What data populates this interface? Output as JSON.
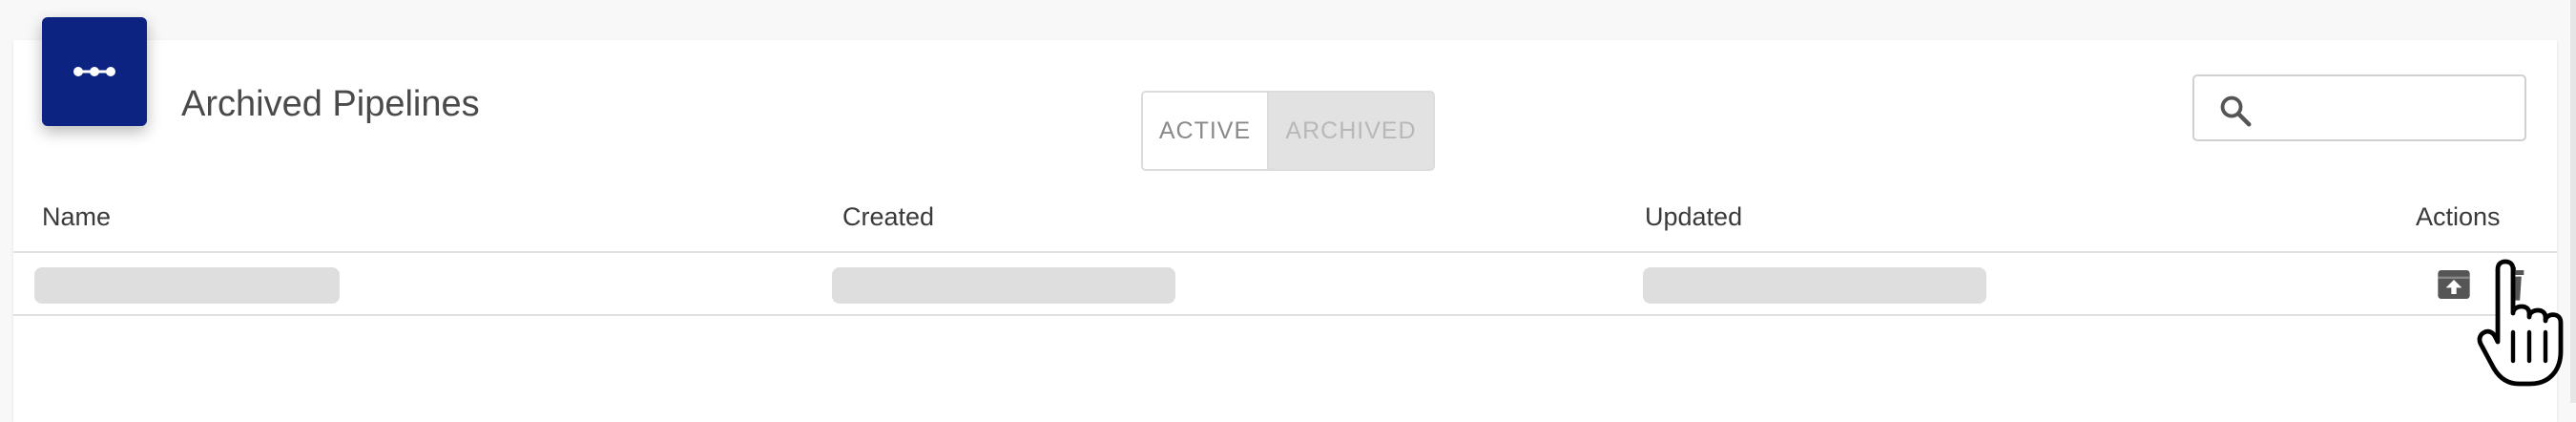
{
  "header": {
    "title": "Archived Pipelines"
  },
  "view_toggle": {
    "active_label": "ACTIVE",
    "archived_label": "ARCHIVED",
    "selected": "ARCHIVED"
  },
  "search": {
    "value": "",
    "placeholder": ""
  },
  "table": {
    "columns": [
      "Name",
      "Created",
      "Updated",
      "Actions"
    ],
    "rows": [
      {
        "name": "",
        "created": "",
        "updated": "",
        "actions": [
          "unarchive-icon",
          "trash-icon"
        ]
      }
    ]
  },
  "colors": {
    "brand": "#0d2381",
    "toggle_selected_bg": "#e2e2e2",
    "skeleton": "#dedede",
    "action_icon": "#555555"
  },
  "icons": {
    "card_icon": "pipeline-icon",
    "search": "search-icon",
    "unarchive": "unarchive-icon",
    "delete": "trash-icon",
    "cursor": "hand-pointer-cursor"
  }
}
